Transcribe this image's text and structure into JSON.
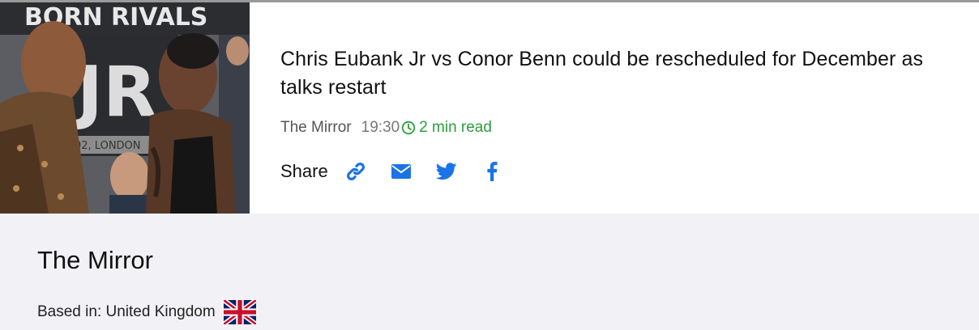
{
  "article": {
    "headline": "Chris Eubank Jr vs Conor Benn could be rescheduled for December as talks restart",
    "source": "The Mirror",
    "time": "19:30",
    "read_time": "2 min read",
    "share_label": "Share",
    "image_banner_text": "BORN RIVALS",
    "image_backdrop_text": "JR",
    "image_date_text": "02, LONDON"
  },
  "share_icons": [
    "link-icon",
    "email-icon",
    "twitter-icon",
    "facebook-icon"
  ],
  "publisher": {
    "name": "The Mirror",
    "based_in": "Based in: United Kingdom",
    "flag": "uk-flag-icon"
  },
  "colors": {
    "accent_blue": "#1a73e8",
    "read_time_green": "#2a9d3a",
    "about_bg": "#f2f1f5"
  }
}
